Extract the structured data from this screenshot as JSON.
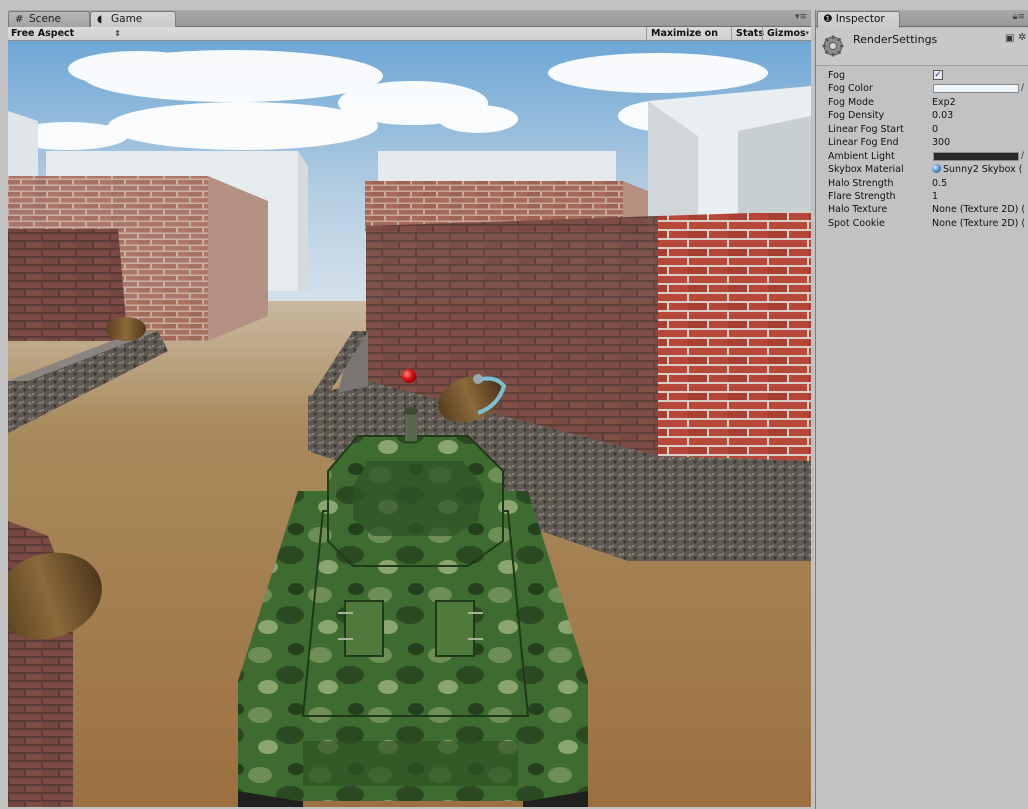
{
  "game_window": {
    "tabs": [
      {
        "label": "Scene",
        "icon": "scene-grid-icon",
        "active": false
      },
      {
        "label": "Game",
        "icon": "game-pacman-icon",
        "active": true
      }
    ],
    "tab_menu_icon": "tab-menu-icon",
    "toolbar": {
      "aspect_label": "Free Aspect",
      "aspect_arrows": "⇕",
      "maximize_label": "Maximize on Play",
      "stats_label": "Stats",
      "gizmos_label": "Gizmos",
      "gizmos_dropdown": "▾"
    }
  },
  "scene_colors": {
    "sky_top": "#6fa7d6",
    "sky_bottom": "#dfe8ee",
    "brick": "#b8483a",
    "gravel": "#6b6560",
    "ground": "#a97e4c",
    "tank_green": "#3e6b2f",
    "ball_red": "#e01818"
  },
  "inspector": {
    "tab_label": "Inspector",
    "tab_icon": "info-icon",
    "lock_icon": "lock-icon",
    "title": "RenderSettings",
    "title_icon": "gear-icon",
    "help_icon": "help-book-icon",
    "settings_icon": "settings-cog-icon",
    "properties": [
      {
        "label": "Fog",
        "type": "checkbox",
        "checked": true,
        "mark": "✓"
      },
      {
        "label": "Fog Color",
        "type": "color",
        "color": "#eef5fa"
      },
      {
        "label": "Fog Mode",
        "type": "text",
        "value": "Exp2"
      },
      {
        "label": "Fog Density",
        "type": "text",
        "value": "0.03"
      },
      {
        "label": "Linear Fog Start",
        "type": "text",
        "value": "0"
      },
      {
        "label": "Linear Fog End",
        "type": "text",
        "value": "300"
      },
      {
        "label": "Ambient Light",
        "type": "color",
        "color": "#2a2a2a"
      },
      {
        "label": "Skybox Material",
        "type": "object",
        "value": "Sunny2 Skybox ("
      },
      {
        "label": "Halo Strength",
        "type": "text",
        "value": "0.5"
      },
      {
        "label": "Flare Strength",
        "type": "text",
        "value": "1"
      },
      {
        "label": "Halo Texture",
        "type": "text",
        "value": "None (Texture 2D) ("
      },
      {
        "label": "Spot Cookie",
        "type": "text",
        "value": "None (Texture 2D) ("
      }
    ],
    "picker_glyph": "∕"
  }
}
